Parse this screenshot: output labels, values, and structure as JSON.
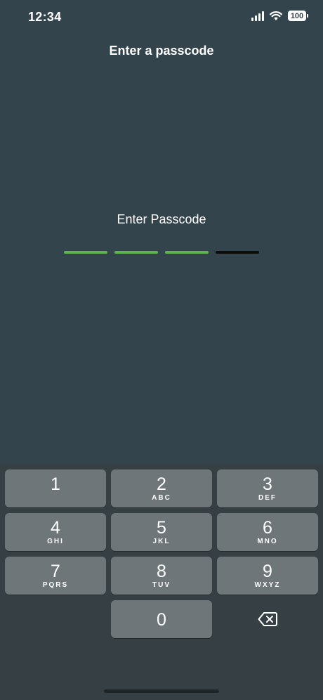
{
  "status_bar": {
    "time": "12:34",
    "battery": "100"
  },
  "nav": {
    "title": "Enter a passcode"
  },
  "passcode": {
    "prompt": "Enter Passcode",
    "length": 4,
    "entered": 3,
    "filled_color": "#5fb34e",
    "empty_color": "#0d0d0d"
  },
  "keypad": {
    "keys": [
      {
        "digit": "1",
        "letters": ""
      },
      {
        "digit": "2",
        "letters": "ABC"
      },
      {
        "digit": "3",
        "letters": "DEF"
      },
      {
        "digit": "4",
        "letters": "GHI"
      },
      {
        "digit": "5",
        "letters": "JKL"
      },
      {
        "digit": "6",
        "letters": "MNO"
      },
      {
        "digit": "7",
        "letters": "PQRS"
      },
      {
        "digit": "8",
        "letters": "TUV"
      },
      {
        "digit": "9",
        "letters": "WXYZ"
      },
      {
        "digit": "0",
        "letters": ""
      }
    ],
    "delete_icon": "delete-backspace-icon"
  }
}
